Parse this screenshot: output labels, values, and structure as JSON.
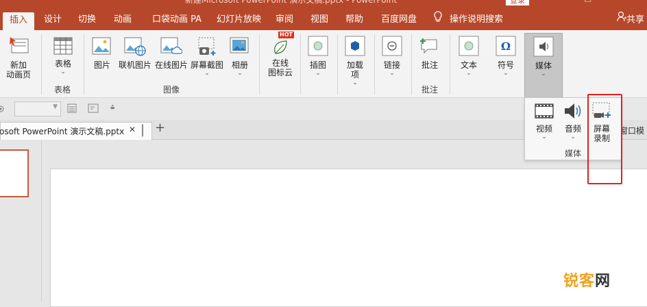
{
  "title_bar": {
    "text": "新建Microsoft PowerPoint 演示文稿.pptx - PowerPoint",
    "login": "登录"
  },
  "tabs": [
    {
      "label": "插入",
      "active": true
    },
    {
      "label": "设计"
    },
    {
      "label": "切换"
    },
    {
      "label": "动画"
    },
    {
      "label": "口袋动画 PA"
    },
    {
      "label": "幻灯片放映"
    },
    {
      "label": "审阅"
    },
    {
      "label": "视图"
    },
    {
      "label": "帮助"
    },
    {
      "label": "百度网盘"
    },
    {
      "label": "操作说明搜索"
    }
  ],
  "share_label": "共享",
  "ribbon": {
    "new_anim_page": "新加\n动画页",
    "table": "表格",
    "table_group": "表格",
    "picture": "图片",
    "online_pic_link": "联机图片",
    "online_pic": "在线图片",
    "screenshot": "屏幕截图",
    "album": "相册",
    "image_group": "图像",
    "icon_cloud": "在线\n图标云",
    "hot_badge": "HOT",
    "illustration": "插图",
    "addins": "加载\n项",
    "link": "链接",
    "comment": "批注",
    "comment_group": "批注",
    "text": "文本",
    "symbol": "符号",
    "media": "媒体"
  },
  "media_panel": {
    "video": "视频",
    "audio": "音频",
    "screen_record": "屏幕\n录制",
    "group_label": "媒体"
  },
  "doc_tab": {
    "name": "osoft PowerPoint 演示文稿.pptx",
    "close": "✕",
    "add": "+"
  },
  "side_text": "窗口模",
  "watermark": {
    "part1": "锐客",
    "part2": "网"
  },
  "colors": {
    "accent": "#b7472a",
    "highlight": "#e02020"
  }
}
